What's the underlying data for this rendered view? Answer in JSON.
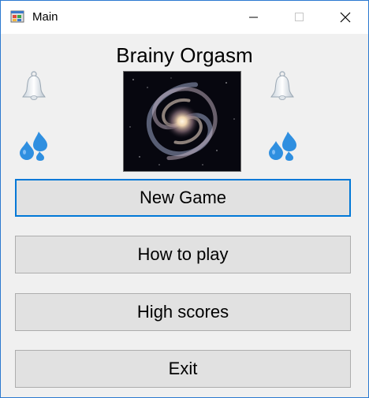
{
  "window": {
    "title": "Main",
    "icon": "app-form-icon",
    "controls": [
      "minimize-icon",
      "maximize-icon",
      "close-icon"
    ]
  },
  "game": {
    "title": "Brainy Orgasm",
    "image": "galaxy-image",
    "decorations": [
      "bell-icon",
      "bell-icon",
      "droplets-icon",
      "droplets-icon"
    ]
  },
  "menu": {
    "new_game": "New Game",
    "how_to_play": "How to play",
    "high_scores": "High scores",
    "exit": "Exit"
  },
  "colors": {
    "accent": "#0078d7",
    "window_border": "#2b79d0",
    "button_bg": "#e1e1e1",
    "form_bg": "#f0f0f0",
    "droplet_blue": "#2f8fe0"
  }
}
